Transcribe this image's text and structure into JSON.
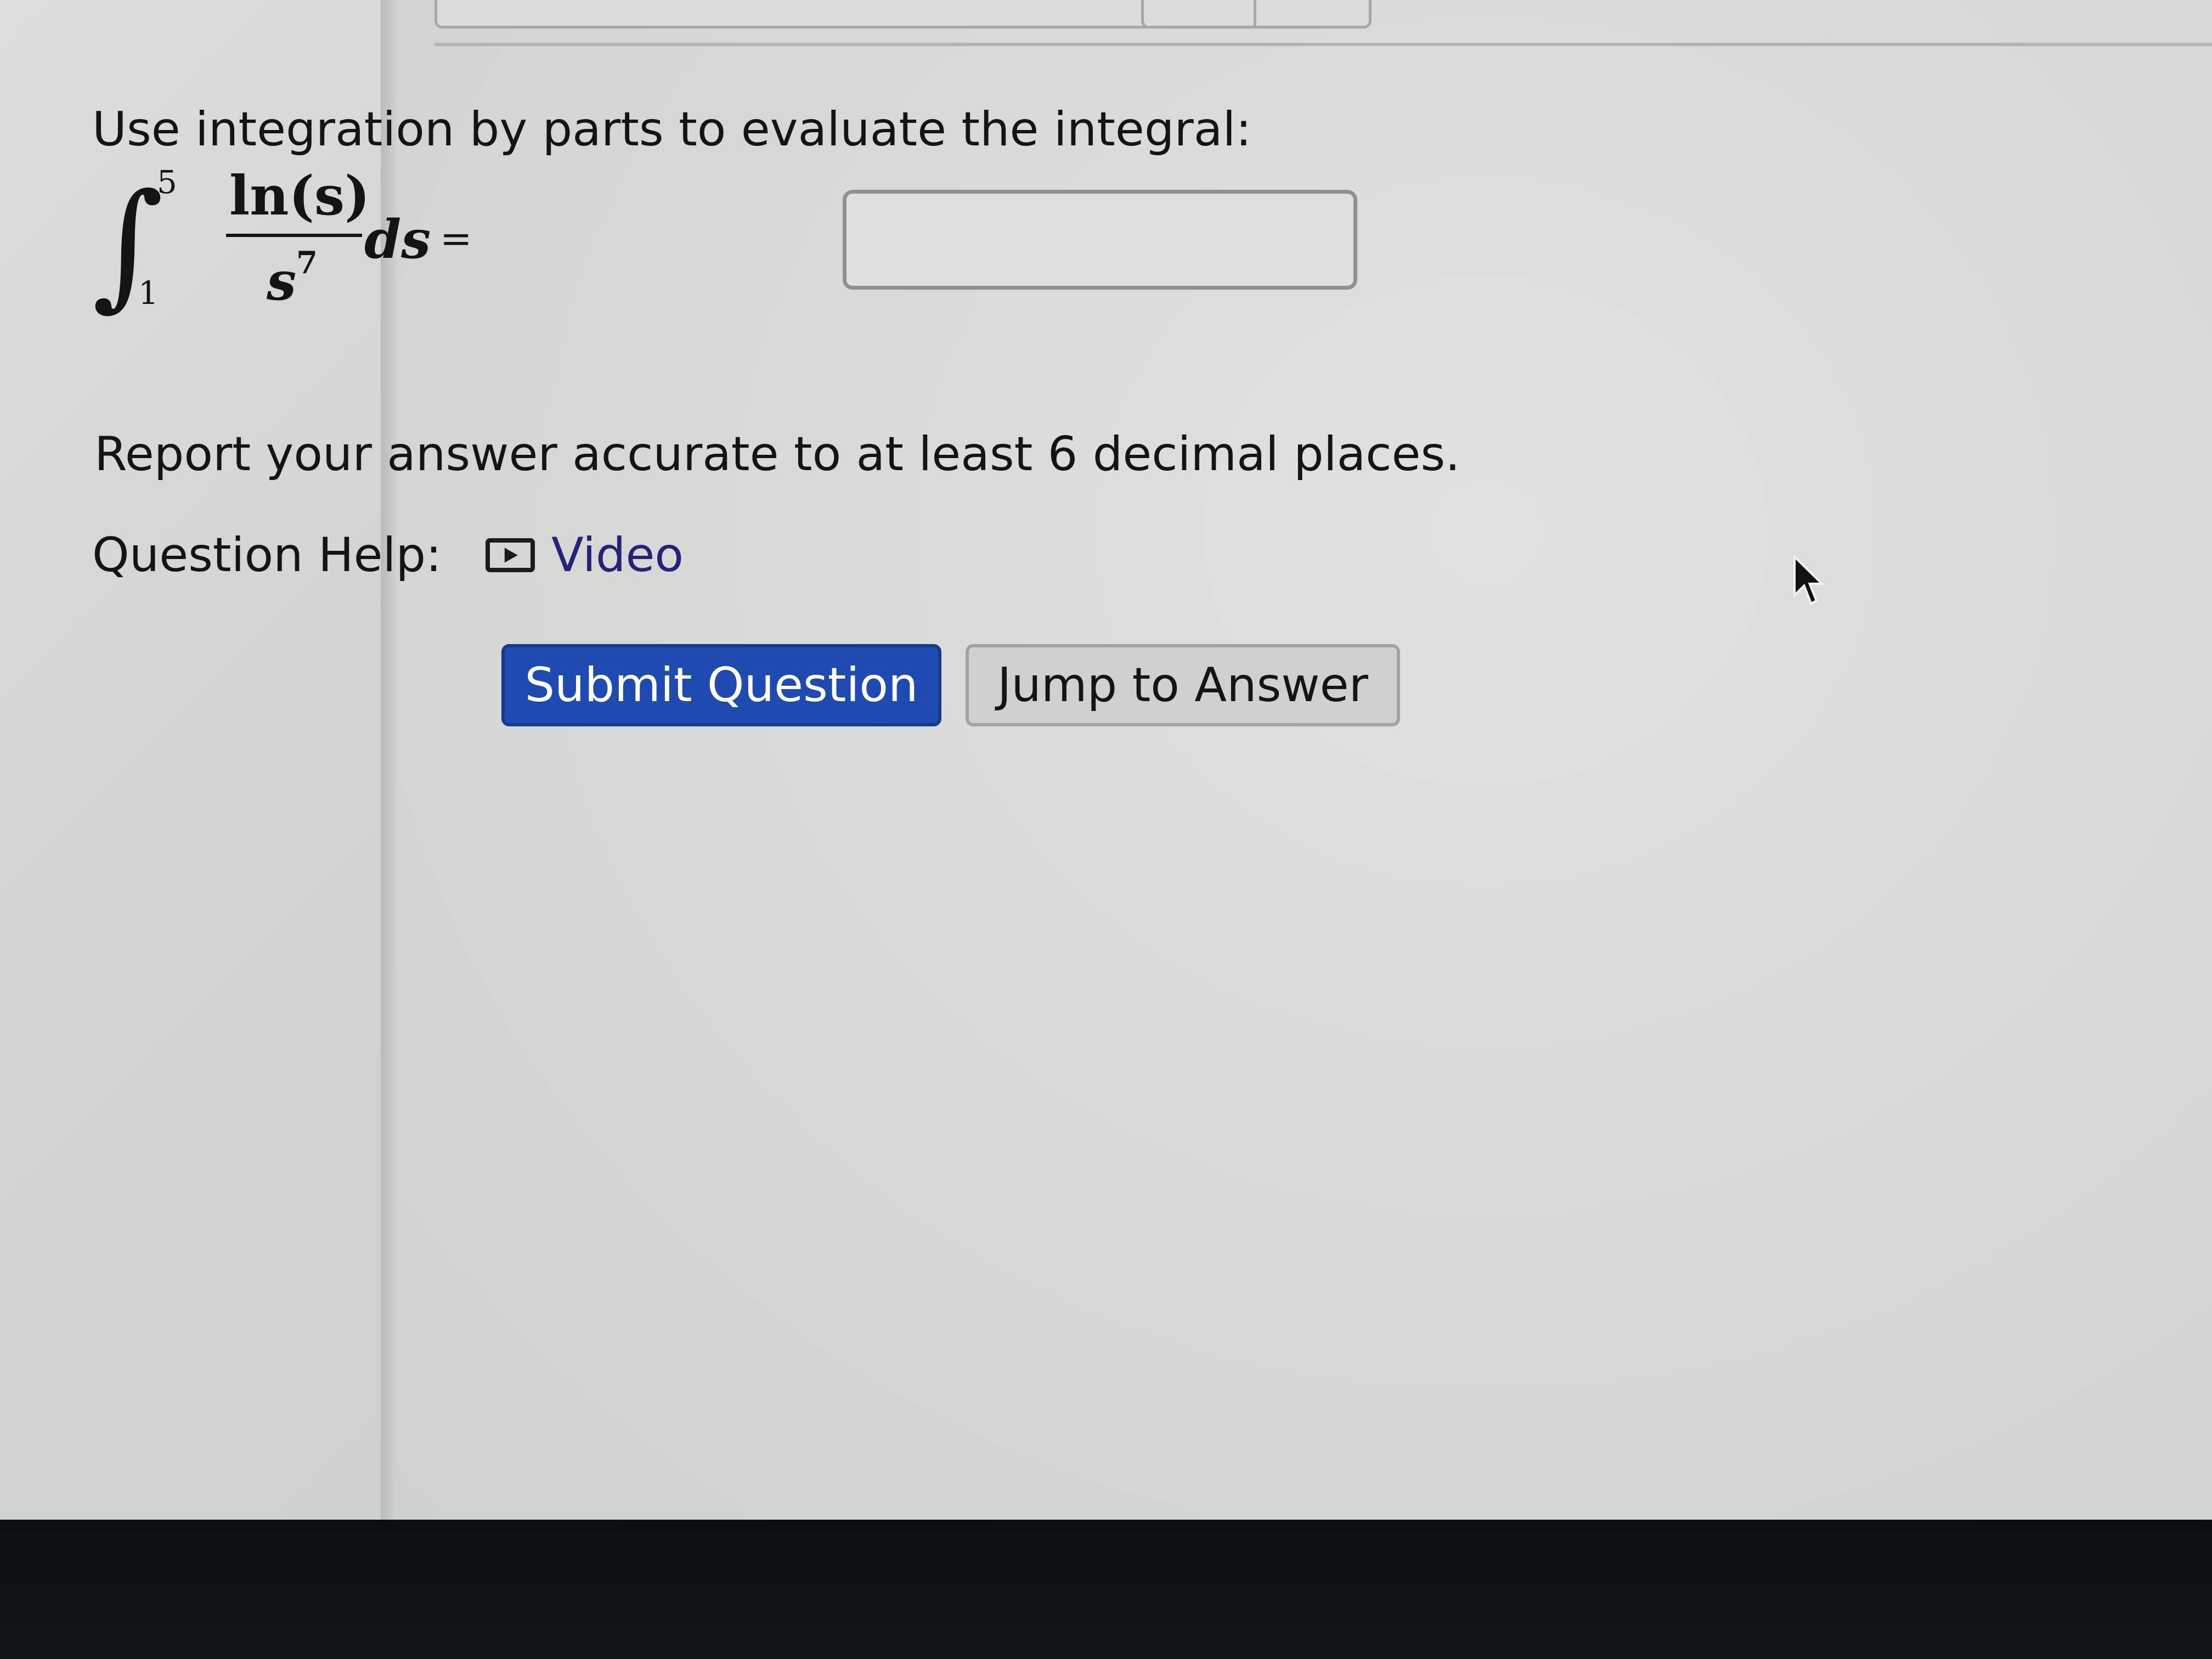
{
  "question": {
    "prompt": "Use integration by parts to evaluate the integral:",
    "integral": {
      "upper_limit": "5",
      "lower_limit": "1",
      "numerator": "ln(s)",
      "denominator_base": "s",
      "denominator_exponent": "7",
      "differential": "ds",
      "equals": "="
    },
    "answer_value": "",
    "instructions": "Report your answer accurate to at least 6 decimal places."
  },
  "help": {
    "label": "Question Help:",
    "video_link": "Video"
  },
  "buttons": {
    "submit": "Submit Question",
    "jump": "Jump to Answer"
  },
  "icons": {
    "integral_sign": "∫",
    "video": "video-play-icon",
    "cursor": "mouse-pointer-icon"
  },
  "colors": {
    "submit_button": "#1f4bb0",
    "video_link": "#23237a"
  }
}
